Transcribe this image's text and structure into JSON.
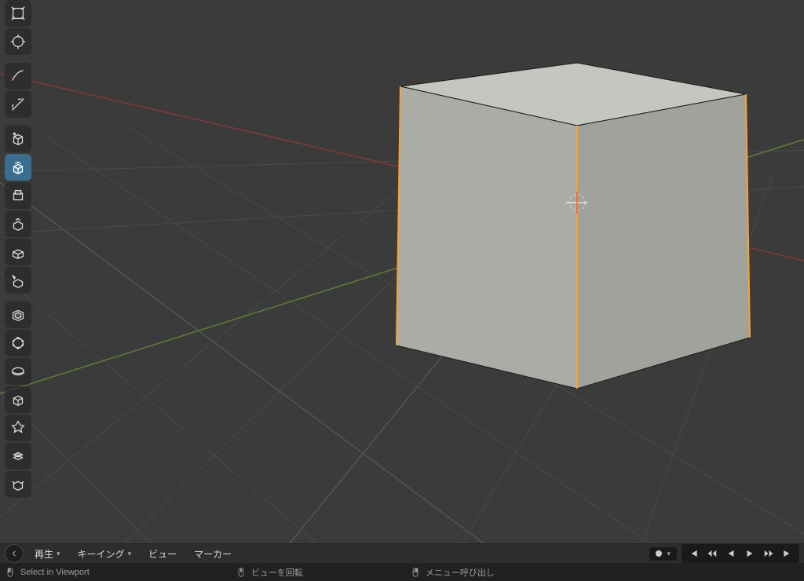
{
  "toolbar": {
    "tools": [
      {
        "id": "scale-cage-tool"
      },
      {
        "id": "transform-tool"
      },
      {
        "spacer": true
      },
      {
        "id": "annotate-tool"
      },
      {
        "id": "measure-tool"
      },
      {
        "spacer": true
      },
      {
        "id": "add-cube-tool"
      },
      {
        "id": "extrude-region-tool",
        "active": true
      },
      {
        "id": "extrude-manifold-tool"
      },
      {
        "id": "extrude-normals-tool"
      },
      {
        "id": "extrude-individual-tool"
      },
      {
        "id": "extrude-cursor-tool"
      },
      {
        "spacer": true
      },
      {
        "id": "inset-faces-tool"
      },
      {
        "id": "bevel-tool"
      },
      {
        "id": "loop-cut-tool"
      },
      {
        "id": "knife-tool"
      },
      {
        "id": "poly-build-tool"
      },
      {
        "id": "spin-tool"
      },
      {
        "id": "spin-duplicates-tool"
      }
    ]
  },
  "timeline": {
    "play_menu": "再生",
    "keying_menu": "キーイング",
    "view_menu": "ビュー",
    "marker_menu": "マーカー"
  },
  "status": {
    "select": "Select in Viewport",
    "rotate": "ビューを回転",
    "context": "メニュー呼び出し"
  }
}
